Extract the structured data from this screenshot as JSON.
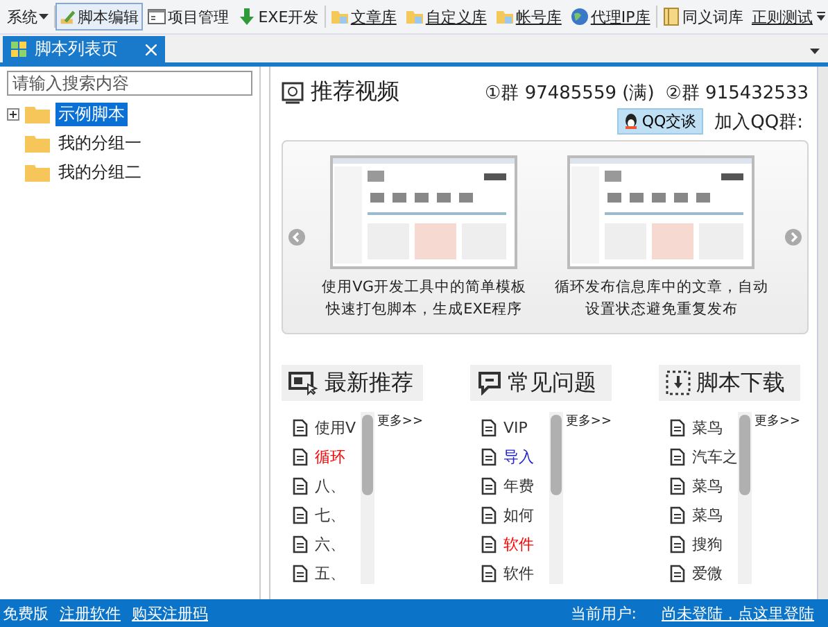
{
  "toolbar": {
    "menu": "系统",
    "groups": [
      [
        {
          "label": "脚本编辑",
          "kind": "pencil",
          "selected": true,
          "link": false
        },
        {
          "label": "项目管理",
          "kind": "window",
          "selected": false,
          "link": false
        },
        {
          "label": "EXE开发",
          "kind": "download",
          "selected": false,
          "link": false
        }
      ],
      [
        {
          "label": "文章库",
          "kind": "folder",
          "selected": false,
          "link": true
        },
        {
          "label": "自定义库",
          "kind": "folder",
          "selected": false,
          "link": true
        },
        {
          "label": "帐号库",
          "kind": "folder",
          "selected": false,
          "link": true
        },
        {
          "label": "代理IP库",
          "kind": "globe",
          "selected": false,
          "link": true
        }
      ],
      [
        {
          "label": "同义词库",
          "kind": "book",
          "selected": false,
          "link": false
        },
        {
          "label": "正则测试",
          "kind": "text",
          "selected": false,
          "link": true
        }
      ]
    ]
  },
  "tabs": [
    {
      "label": "脚本列表页",
      "selected": true
    }
  ],
  "sidebar": {
    "search": {
      "placeholder": "请输入搜索内容"
    },
    "items": [
      {
        "label": "示例脚本",
        "selected": true,
        "kind": "collapsed"
      },
      {
        "label": "我的分组一",
        "selected": false,
        "kind": "leaf"
      },
      {
        "label": "我的分组二",
        "selected": false,
        "kind": "leaf"
      }
    ]
  },
  "video": {
    "title": "推荐视频",
    "groups": [
      "①群 97485559 (满)",
      "②群 915432533"
    ],
    "qq_button": "QQ交谈",
    "join_label": "加入QQ群:",
    "slides": [
      {
        "caption_lines": [
          "使用VG开发工具中的简单模板",
          "快速打包脚本，生成EXE程序"
        ]
      },
      {
        "caption_lines": [
          "循环发布信息库中的文章，自动",
          "设置状态避免重复发布"
        ]
      }
    ]
  },
  "sections": [
    {
      "title": "最新推荐",
      "kind": "monitor",
      "more": "更多>>",
      "items": [
        {
          "text": "使用V",
          "color": "#333333"
        },
        {
          "text": "循环",
          "color": "#ff0000"
        },
        {
          "text": "八、",
          "color": "#333333"
        },
        {
          "text": "七、",
          "color": "#333333"
        },
        {
          "text": "六、",
          "color": "#333333"
        },
        {
          "text": "五、",
          "color": "#333333"
        }
      ]
    },
    {
      "title": "常见问题",
      "kind": "chat",
      "more": "更多>>",
      "items": [
        {
          "text": "VIP",
          "color": "#333333"
        },
        {
          "text": "导入",
          "color": "#2222cc"
        },
        {
          "text": "年费",
          "color": "#333333"
        },
        {
          "text": "如何",
          "color": "#333333"
        },
        {
          "text": "软件",
          "color": "#ff0000"
        },
        {
          "text": "软件",
          "color": "#333333"
        }
      ]
    },
    {
      "title": "脚本下载",
      "kind": "download",
      "more": "更多>>",
      "items": [
        {
          "text": "菜鸟",
          "color": "#333333"
        },
        {
          "text": "汽车之",
          "color": "#333333"
        },
        {
          "text": "菜鸟",
          "color": "#333333"
        },
        {
          "text": "菜鸟",
          "color": "#333333"
        },
        {
          "text": "搜狗",
          "color": "#333333"
        },
        {
          "text": "爱微",
          "color": "#333333"
        }
      ]
    }
  ],
  "status_bar": {
    "edition": "免费版",
    "links": [
      "注册软件",
      "购买注册码"
    ],
    "user_label": "当前用户:",
    "login_link": "尚未登陆，点这里登陆"
  }
}
